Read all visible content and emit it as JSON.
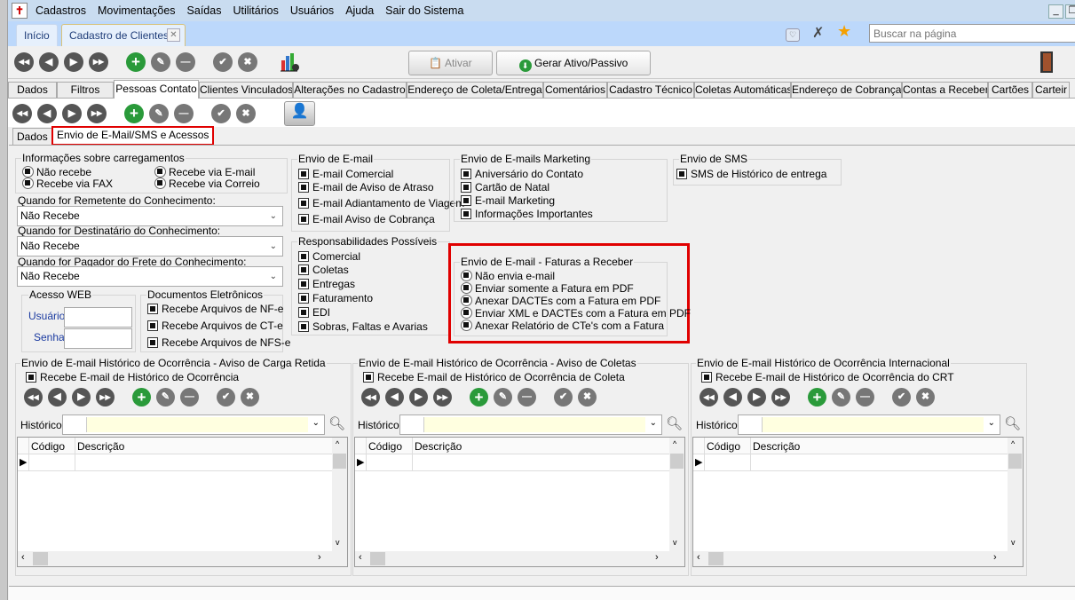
{
  "menu": [
    "Cadastros",
    "Movimentações",
    "Saídas",
    "Utilitários",
    "Usuários",
    "Ajuda",
    "Sair do Sistema"
  ],
  "doc_tabs": {
    "home": "Início",
    "active": "Cadastro de Clientes"
  },
  "search": {
    "placeholder": "Buscar na página"
  },
  "toolbar": {
    "ativar": "Ativar",
    "gerar": "Gerar Ativo/Passivo"
  },
  "main_tabs": [
    "Dados",
    "Filtros",
    "Pessoas Contato",
    "Clientes Vinculados",
    "Alterações no Cadastro",
    "Endereço de Coleta/Entrega",
    "Comentários",
    "Cadastro Técnico",
    "Coletas Automáticas",
    "Endereço de Cobrança",
    "Contas a Receber",
    "Cartões",
    "Carteir"
  ],
  "sub_tabs": [
    "Dados",
    "Envio de E-Mail/SMS e Acessos"
  ],
  "carregamentos": {
    "title": "Informações sobre carregamentos",
    "options": [
      "Não recebe",
      "Recebe via E-mail",
      "Recebe via FAX",
      "Recebe via Correio"
    ]
  },
  "selects": [
    {
      "label": "Quando for Remetente do Conhecimento:",
      "value": "Não Recebe"
    },
    {
      "label": "Quando for Destinatário do Conhecimento:",
      "value": "Não Recebe"
    },
    {
      "label": "Quando for Pagador do Frete do Conhecimento:",
      "value": "Não Recebe"
    }
  ],
  "acesso_web": {
    "title": "Acesso WEB",
    "usuario": "Usuário",
    "senha": "Senha"
  },
  "documentos": {
    "title": "Documentos Eletrônicos",
    "items": [
      "Recebe Arquivos de NF-e",
      "Recebe Arquivos de CT-e",
      "Recebe Arquivos de NFS-e"
    ]
  },
  "envio_email": {
    "title": "Envio de E-mail",
    "items": [
      "E-mail Comercial",
      "E-mail de Aviso de Atraso",
      "E-mail Adiantamento de Viagem",
      "E-mail Aviso de Cobrança"
    ]
  },
  "responsabilidades": {
    "title": "Responsabilidades Possíveis",
    "items": [
      "Comercial",
      "Coletas",
      "Entregas",
      "Faturamento",
      "EDI",
      "Sobras, Faltas e Avarias"
    ]
  },
  "marketing": {
    "title": "Envio de E-mails Marketing",
    "items": [
      "Aniversário do Contato",
      "Cartão de Natal",
      "E-mail Marketing",
      "Informações Importantes"
    ]
  },
  "sms": {
    "title": "Envio de SMS",
    "items": [
      "SMS de Histórico de entrega"
    ]
  },
  "faturas": {
    "title": "Envio de E-mail - Faturas a Receber",
    "options": [
      "Não envia e-mail",
      "Enviar somente a Fatura em PDF",
      "Anexar DACTEs com a Fatura em PDF",
      "Enviar XML e DACTEs com a Fatura em PDF",
      "Anexar Relatório de CTe's com a Fatura"
    ]
  },
  "panels": [
    {
      "title": "Envio de E-mail Histórico de Ocorrência - Aviso de Carga Retida",
      "checkbox": "Recebe E-mail de Histórico de Ocorrência",
      "historico": "Histórico",
      "col_codigo": "Código",
      "col_descricao": "Descrição"
    },
    {
      "title": "Envio de E-mail Histórico de Ocorrência - Aviso de Coletas",
      "checkbox": "Recebe E-mail de Histórico de Ocorrência de Coleta",
      "historico": "Histórico",
      "col_codigo": "Código",
      "col_descricao": "Descrição"
    },
    {
      "title": "Envio de E-mail Histórico de Ocorrência Internacional",
      "checkbox": "Recebe E-mail de Histórico de Ocorrência do CRT",
      "historico": "Histórico",
      "col_codigo": "Código",
      "col_descricao": "Descrição"
    }
  ],
  "colors": {
    "highlight": "#e00000",
    "add_green": "#2a9a3a",
    "menu_bg": "#c9dcf0"
  }
}
